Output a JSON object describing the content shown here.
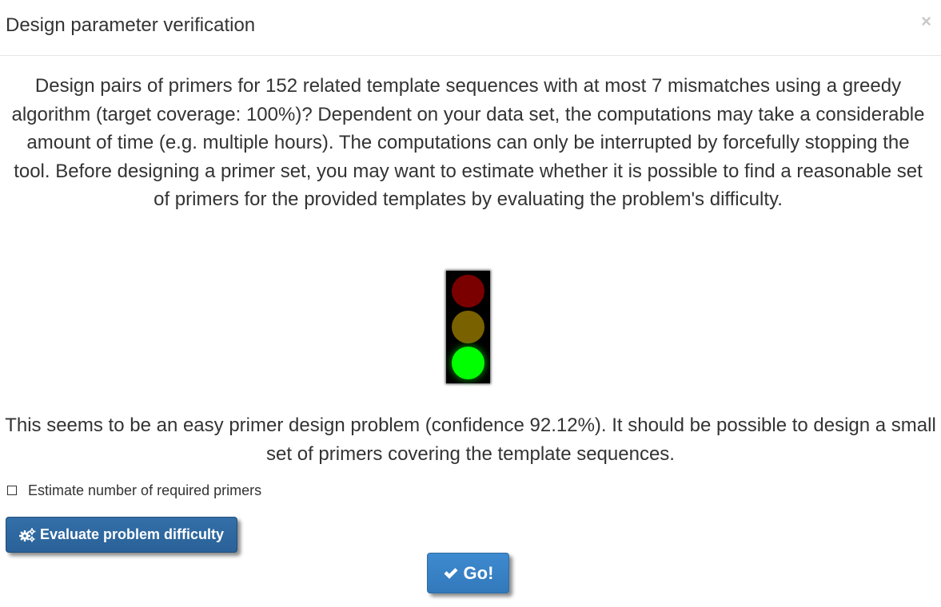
{
  "dialog": {
    "title": "Design parameter verification",
    "close_symbol": "×"
  },
  "message": {
    "text": "Design pairs of primers for 152 related template sequences with at most 7 mismatches using a greedy algorithm (target coverage: 100%)? Dependent on your data set, the computations may take a considerable amount of time (e.g. multiple hours). The computations can only be interrupted by forcefully stopping the tool. Before designing a primer set, you may want to estimate whether it is possible to find a reasonable set of primers for the provided templates by evaluating the problem's difficulty."
  },
  "traffic_light": {
    "active_lamp": "green",
    "colors": {
      "red_off": "#7a0000",
      "yellow_off": "#7a6100",
      "green_on": "#00ff00"
    }
  },
  "result": {
    "text": "This seems to be an easy primer design problem (confidence 92.12%). It should be possible to design a small set of primers covering the template sequences."
  },
  "options": {
    "estimate_label": "Estimate number of required primers",
    "estimate_checked": false
  },
  "buttons": {
    "evaluate_label": "Evaluate problem difficulty",
    "evaluate_icon": "gears-icon",
    "go_label": "Go!",
    "go_icon": "checkmark-icon"
  },
  "colors": {
    "primary": "#2e6da4",
    "go_button": "#3a84c6"
  }
}
